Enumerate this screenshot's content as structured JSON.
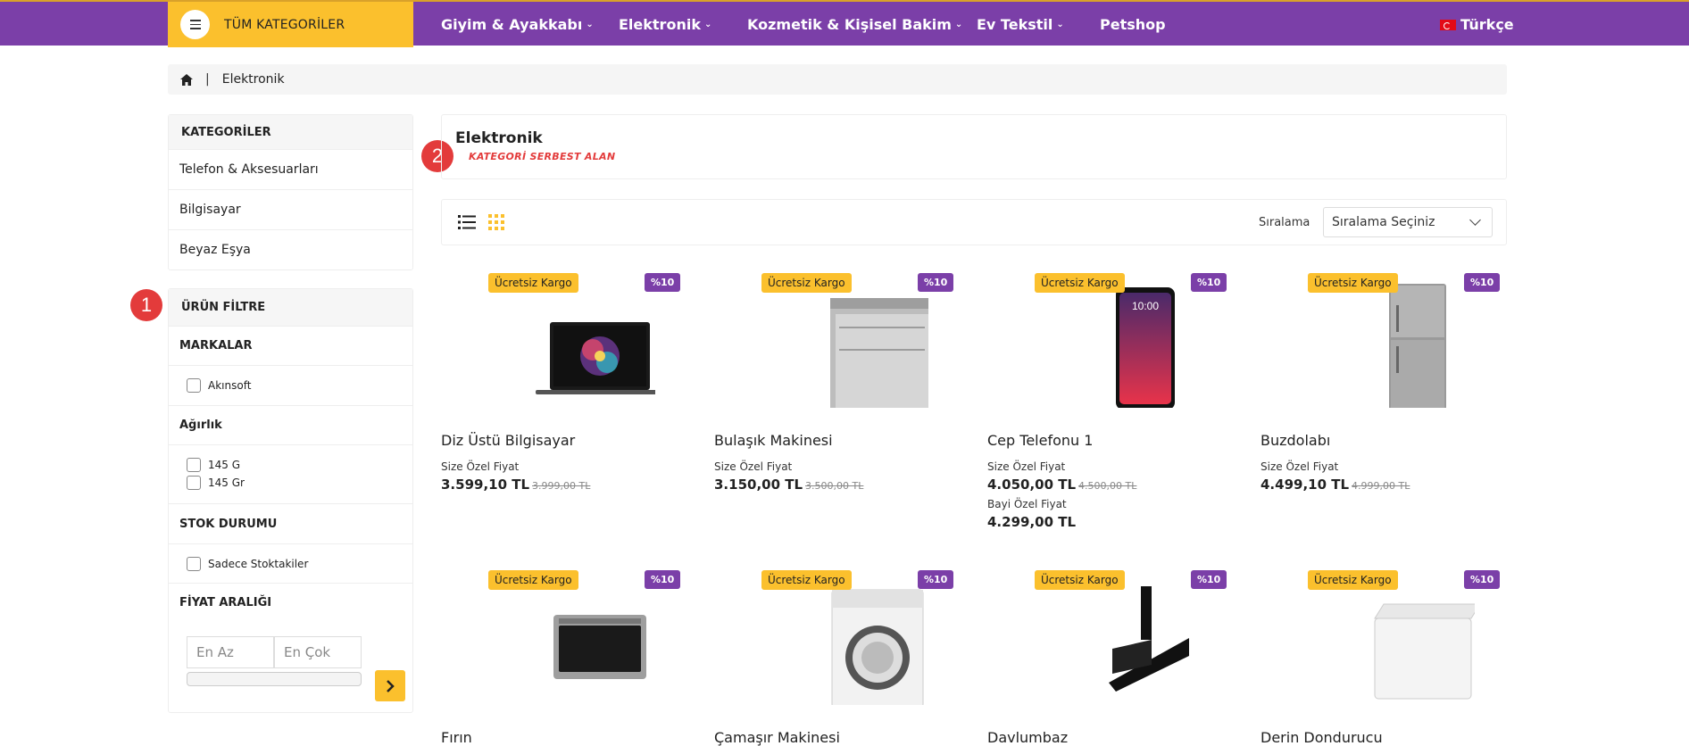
{
  "header": {
    "all_categories": "TÜM KATEGORİLER",
    "nav": [
      {
        "label": "Giyim & Ayakkabı",
        "chevron": true
      },
      {
        "label": "Elektronik",
        "chevron": true
      },
      {
        "label": "Kozmetik & Kişisel Bakim",
        "chevron": true
      },
      {
        "label": "Ev Tekstil",
        "chevron": true
      },
      {
        "label": "Petshop",
        "chevron": false
      }
    ],
    "language": "Türkçe",
    "colors": {
      "bar": "#7b3fa8",
      "accent": "#fbc02d"
    }
  },
  "breadcrumb": {
    "current": "Elektronik",
    "separator": "|"
  },
  "sidebar": {
    "categories_title": "KATEGORİLER",
    "categories": [
      "Telefon & Aksesuarları",
      "Bilgisayar",
      "Beyaz Eşya"
    ],
    "filter_title": "ÜRÜN FİLTRE",
    "brands_title": "MARKALAR",
    "brands": [
      "Akınsoft"
    ],
    "weight_title": "Ağırlık",
    "weights": [
      "145 G",
      "145 Gr"
    ],
    "stock_title": "STOK DURUMU",
    "stock_option": "Sadece Stoktakiler",
    "price_title": "FİYAT ARALIĞI",
    "price_min_placeholder": "En Az",
    "price_max_placeholder": "En Çok"
  },
  "markers": [
    "1",
    "2"
  ],
  "category": {
    "title": "Elektronik",
    "subtitle": "KATEGORİ SERBEST ALAN"
  },
  "toolbar": {
    "sort_label": "Sıralama",
    "sort_value": "Sıralama Seçiniz"
  },
  "products": [
    {
      "name": "Diz Üstü Bilgisayar",
      "badge": "Ücretsiz Kargo",
      "discount": "%10",
      "price_label": "Size Özel Fiyat",
      "price": "3.599,10 TL",
      "old_price": "3.999,00 TL",
      "icon": "laptop"
    },
    {
      "name": "Bulaşık Makinesi",
      "badge": "Ücretsiz Kargo",
      "discount": "%10",
      "price_label": "Size Özel Fiyat",
      "price": "3.150,00 TL",
      "old_price": "3.500,00 TL",
      "icon": "dishwasher"
    },
    {
      "name": "Cep Telefonu 1",
      "badge": "Ücretsiz Kargo",
      "discount": "%10",
      "price_label": "Size Özel Fiyat",
      "price": "4.050,00 TL",
      "old_price": "4.500,00 TL",
      "dealer_label": "Bayi Özel Fiyat",
      "dealer_price": "4.299,00 TL",
      "phone_time": "10:00",
      "icon": "phone"
    },
    {
      "name": "Buzdolabı",
      "badge": "Ücretsiz Kargo",
      "discount": "%10",
      "price_label": "Size Özel Fiyat",
      "price": "4.499,10 TL",
      "old_price": "4.999,00 TL",
      "icon": "fridge"
    },
    {
      "name": "Fırın",
      "badge": "Ücretsiz Kargo",
      "discount": "%10",
      "icon": "oven"
    },
    {
      "name": "Çamaşır Makinesi",
      "badge": "Ücretsiz Kargo",
      "discount": "%10",
      "icon": "washer"
    },
    {
      "name": "Davlumbaz",
      "badge": "Ücretsiz Kargo",
      "discount": "%10",
      "icon": "hood"
    },
    {
      "name": "Derin Dondurucu",
      "badge": "Ücretsiz Kargo",
      "discount": "%10",
      "icon": "freezer"
    }
  ]
}
